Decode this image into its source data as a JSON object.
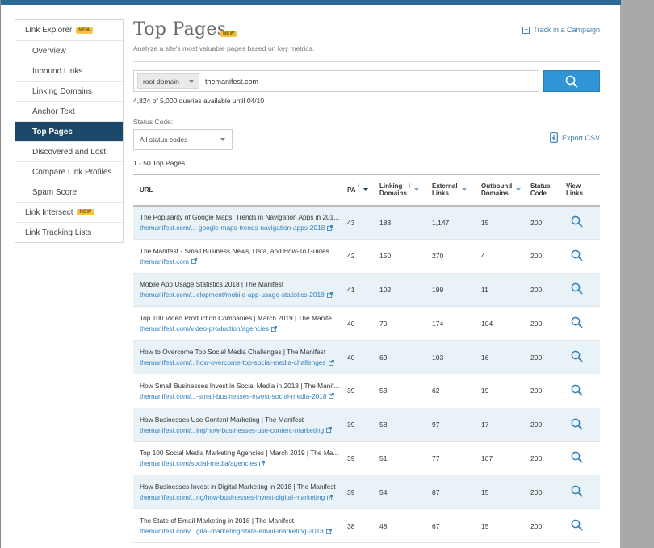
{
  "sidebar": {
    "items": [
      {
        "label": "Link Explorer",
        "badge": "NEW",
        "level": "top"
      },
      {
        "label": "Overview",
        "level": "sub"
      },
      {
        "label": "Inbound Links",
        "level": "sub"
      },
      {
        "label": "Linking Domains",
        "level": "sub"
      },
      {
        "label": "Anchor Text",
        "level": "sub"
      },
      {
        "label": "Top Pages",
        "level": "sub",
        "active": true
      },
      {
        "label": "Discovered and Lost",
        "level": "sub"
      },
      {
        "label": "Compare Link Profiles",
        "level": "sub"
      },
      {
        "label": "Spam Score",
        "level": "sub"
      },
      {
        "label": "Link Intersect",
        "badge": "NEW",
        "level": "top"
      },
      {
        "label": "Link Tracking Lists",
        "level": "top"
      }
    ]
  },
  "header": {
    "title": "Top Pages",
    "title_badge": "NEW",
    "subtitle": "Analyze a site's most valuable pages based on key metrics.",
    "track_label": "Track in a Campaign"
  },
  "search": {
    "scope": "root domain",
    "value": "themanifest.com",
    "quota": "4,824 of 5,000 queries available until 04/10"
  },
  "filters": {
    "status_label": "Status Code:",
    "status_value": "All status codes",
    "export_label": "Export CSV"
  },
  "results": {
    "count": "1 - 50  Top Pages"
  },
  "table": {
    "headers": {
      "url": "URL",
      "pa": "PA",
      "linking_domains_1": "Linking",
      "linking_domains_2": "Domains",
      "external_1": "External",
      "external_2": "Links",
      "outbound_1": "Outbound",
      "outbound_2": "Domains",
      "status_1": "Status",
      "status_2": "Code",
      "view_1": "View",
      "view_2": "Links",
      "info": "i"
    },
    "rows": [
      {
        "title": "The Popularity of Google Maps: Trends in Navigation Apps in 201...",
        "url": "themanifest.com/...-google-maps-trends-navigation-apps-2018",
        "pa": "43",
        "ld": "183",
        "el": "1,147",
        "od": "15",
        "sc": "200"
      },
      {
        "title": "The Manifest - Small Business News, Data, and How-To Guides",
        "url": "themanifest.com",
        "pa": "42",
        "ld": "150",
        "el": "270",
        "od": "4",
        "sc": "200"
      },
      {
        "title": "Mobile App Usage Statistics 2018 | The Manifest",
        "url": "themanifest.com/...elopment/mobile-app-usage-statistics-2018",
        "pa": "41",
        "ld": "102",
        "el": "199",
        "od": "11",
        "sc": "200"
      },
      {
        "title": "Top 100 Video Production Companies | March 2019 | The Manife...",
        "url": "themanifest.com/video-production/agencies",
        "pa": "40",
        "ld": "70",
        "el": "174",
        "od": "104",
        "sc": "200"
      },
      {
        "title": "How to Overcome Top Social Media Challenges | The Manifest",
        "url": "themanifest.com/...how-overcome-top-social-media-challenges",
        "pa": "40",
        "ld": "69",
        "el": "103",
        "od": "16",
        "sc": "200"
      },
      {
        "title": "How Small Businesses Invest in Social Media in 2018 | The Manif...",
        "url": "themanifest.com/...-small-businesses-invest-social-media-2018",
        "pa": "39",
        "ld": "53",
        "el": "62",
        "od": "19",
        "sc": "200"
      },
      {
        "title": "How Businesses Use Content Marketing | The Manifest",
        "url": "themanifest.com/...ing/how-businesses-use-content-marketing",
        "pa": "39",
        "ld": "58",
        "el": "97",
        "od": "17",
        "sc": "200"
      },
      {
        "title": "Top 100 Social Media Marketing Agencies | March 2019 | The Ma...",
        "url": "themanifest.com/social-media/agencies",
        "pa": "39",
        "ld": "51",
        "el": "77",
        "od": "107",
        "sc": "200"
      },
      {
        "title": "How Businesses Invest in Digital Marketing in 2018 | The Manifest",
        "url": "themanifest.com/...ng/how-businesses-invest-digital-marketing",
        "pa": "39",
        "ld": "54",
        "el": "87",
        "od": "15",
        "sc": "200"
      },
      {
        "title": "The State of Email Marketing in 2018 | The Manifest",
        "url": "themanifest.com/...gital-marketing/state-email-marketing-2018",
        "pa": "38",
        "ld": "48",
        "el": "67",
        "od": "15",
        "sc": "200"
      }
    ]
  },
  "colors": {
    "accent": "#2f95d6",
    "active_nav": "#1b4868",
    "link": "#2f7fbd",
    "badge": "#f5c242",
    "row_alt": "#e9f2f6"
  }
}
